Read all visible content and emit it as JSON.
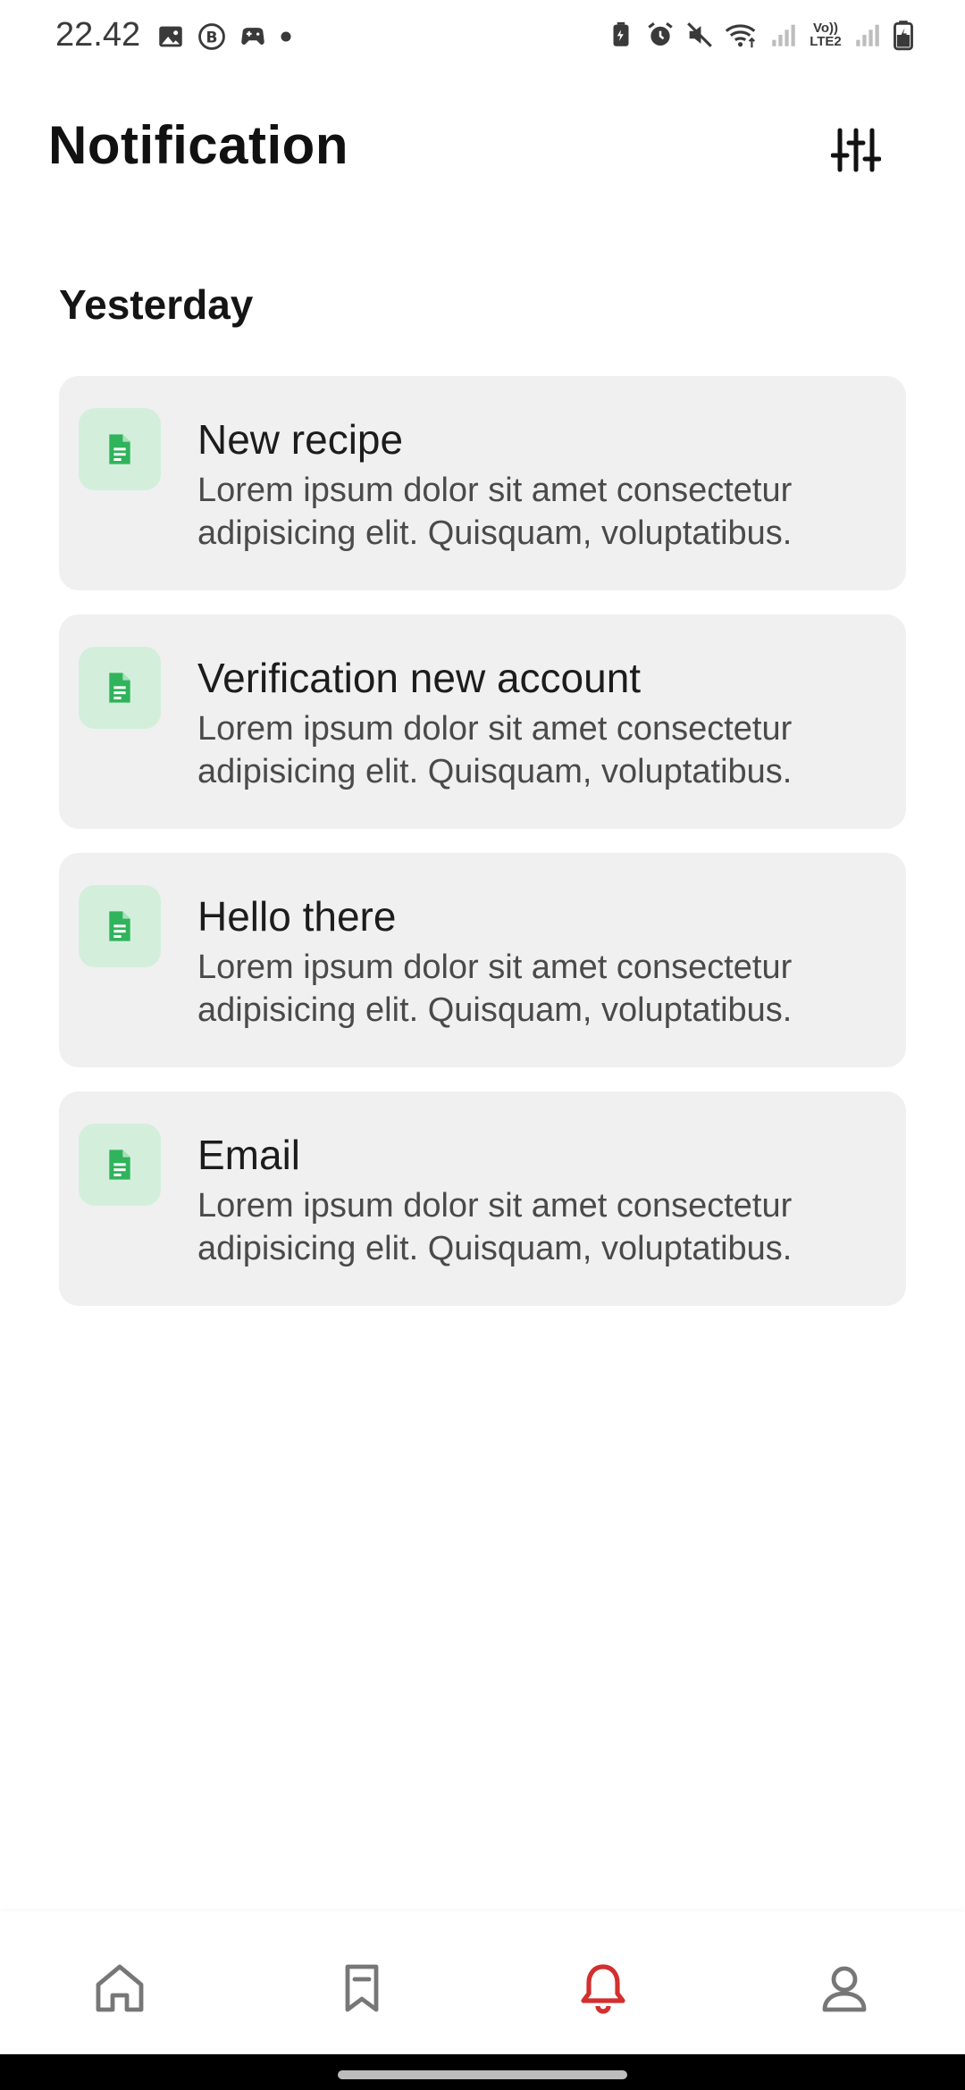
{
  "status_bar": {
    "time": "22.42",
    "volte_line1": "Vo))",
    "volte_line2": "LTE2"
  },
  "header": {
    "title": "Notification",
    "filter_icon": "sliders-icon"
  },
  "section": {
    "title": "Yesterday"
  },
  "notifications": [
    {
      "title": "New recipe",
      "body": "Lorem ipsum dolor sit amet consectetur adipisicing elit. Quisquam, voluptatibus.",
      "icon": "document-icon"
    },
    {
      "title": "Verification new account",
      "body": "Lorem ipsum dolor sit amet consectetur adipisicing elit. Quisquam, voluptatibus.",
      "icon": "document-icon"
    },
    {
      "title": "Hello there",
      "body": "Lorem ipsum dolor sit amet consectetur adipisicing elit. Quisquam, voluptatibus.",
      "icon": "document-icon"
    },
    {
      "title": "Email",
      "body": "Lorem ipsum dolor sit amet consectetur adipisicing elit. Quisquam, voluptatibus.",
      "icon": "document-icon"
    }
  ],
  "bottom_nav": {
    "items": [
      {
        "icon": "home-icon",
        "active": false
      },
      {
        "icon": "bookmark-icon",
        "active": false
      },
      {
        "icon": "bell-icon",
        "active": true
      },
      {
        "icon": "user-icon",
        "active": false
      }
    ]
  },
  "colors": {
    "accent_active": "#d32f2f",
    "icon_green": "#2fb35b",
    "icon_bg": "#d3efdc",
    "card_bg": "#f0f0f0",
    "nav_inactive": "#777777"
  }
}
